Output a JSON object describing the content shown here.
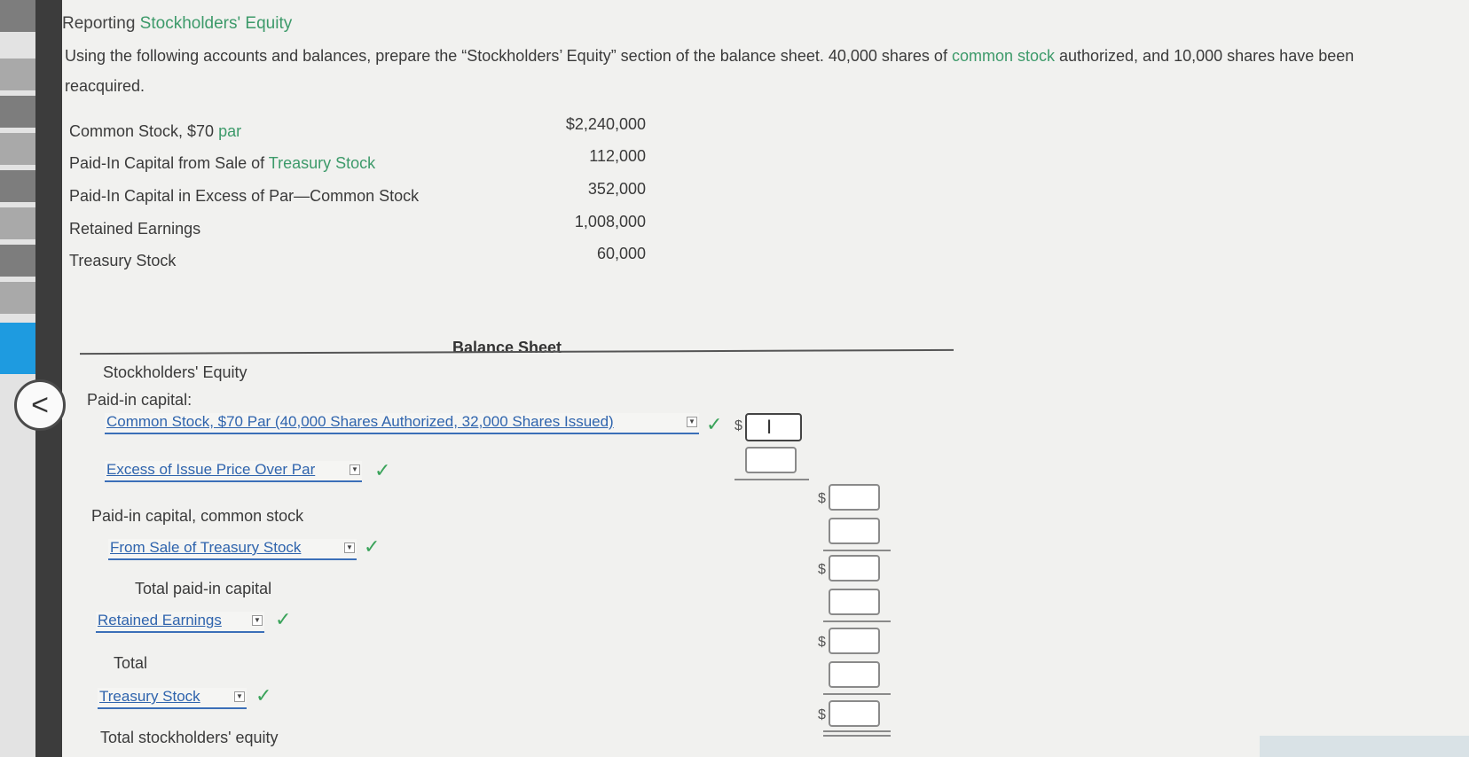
{
  "title": {
    "prefix": "Reporting ",
    "link": "Stockholders' Equity"
  },
  "intro": {
    "part1": "Using the following accounts and balances, prepare the “Stockholders’ Equity” section of the balance sheet. 40,000 shares of ",
    "link": "common stock",
    "part2": " authorized, and 10,000 shares have been reacquired."
  },
  "accounts": [
    {
      "pre": "Common Stock, $70 ",
      "link": "par",
      "post": "",
      "amount": "$2,240,000"
    },
    {
      "pre": "Paid-In Capital from Sale of ",
      "link": "Treasury Stock",
      "post": "",
      "amount": "112,000"
    },
    {
      "pre": "Paid-In Capital in Excess of Par—Common Stock",
      "link": "",
      "post": "",
      "amount": "352,000"
    },
    {
      "pre": "Retained Earnings",
      "link": "",
      "post": "",
      "amount": "1,008,000"
    },
    {
      "pre": "Treasury Stock",
      "link": "",
      "post": "",
      "amount": "60,000"
    }
  ],
  "balance_sheet": {
    "title": "Balance Sheet",
    "section": "Stockholders' Equity",
    "paid_in_capital": "Paid-in capital:",
    "select_common": "Common Stock, $70 Par (40,000 Shares Authorized, 32,000 Shares Issued)",
    "select_excess": "Excess of Issue Price Over Par",
    "paid_in_common": "Paid-in capital, common stock",
    "select_treasury_sale": "From Sale of Treasury Stock",
    "total_paid_in": "Total paid-in capital",
    "select_retained": "Retained Earnings",
    "total": "Total",
    "select_treasury": "Treasury Stock",
    "total_equity": "Total stockholders' equity"
  },
  "symbols": {
    "check": "✓",
    "dollar": "$",
    "caret": "▼",
    "back": "<",
    "text_cursor": "I"
  }
}
